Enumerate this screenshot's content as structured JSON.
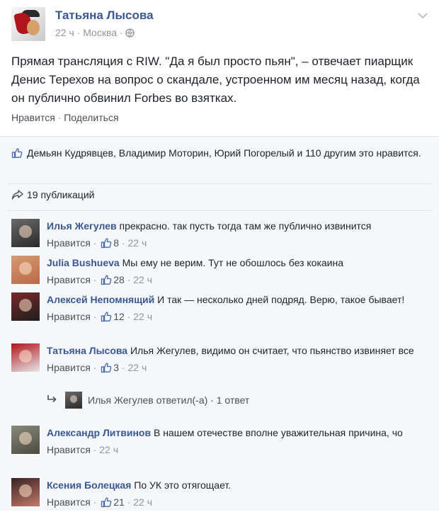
{
  "post": {
    "author": "Татьяна Лысова",
    "time": "22 ч",
    "location": "Москва",
    "meta_sep": " · ",
    "text": "Прямая трансляция с RIW. \"Да я был просто пьян\", – отвечает пиарщик Денис Терехов на вопрос о скандале, устроенном им месяц назад, когда он публично обвинил Forbes во взятках.",
    "like_label": "Нравится",
    "share_label": "Поделиться"
  },
  "feedback": {
    "likes_text": "Демьян Кудрявцев, Владимир Моторин, Юрий Погорелый и 110 другим это нравится.",
    "shares_text": "19 публикаций"
  },
  "comments": [
    {
      "author": "Илья Жегулев",
      "text": " прекрасно. так пусть тогда там же публично извинится",
      "like_label": "Нравится",
      "likes": "8",
      "time": "22 ч",
      "avatar_colors": [
        "#6a6a6a",
        "#2a2a2a"
      ]
    },
    {
      "author": "Julia Bushueva",
      "text": " Мы ему не верим. Тут не обошлось без кокаина",
      "like_label": "Нравится",
      "likes": "28",
      "time": "22 ч",
      "avatar_colors": [
        "#d89a72",
        "#b86a48"
      ]
    },
    {
      "author": "Алексей Непомнящий",
      "text": " И так — несколько дней подряд. Верю, такое бывает!",
      "like_label": "Нравится",
      "likes": "12",
      "time": "22 ч",
      "avatar_colors": [
        "#7a2a2a",
        "#1e1e1e"
      ]
    },
    {
      "author": "Татьяна Лысова",
      "text": " Илья Жегулев, видимо он считает, что пьянство извиняет все",
      "like_label": "Нравится",
      "likes": "3",
      "time": "22 ч",
      "avatar_colors": [
        "#b0151c",
        "#e6e6e6"
      ]
    },
    {
      "author": "Александр Литвинов",
      "text": " В нашем отечестве вполне уважительная причина, чо",
      "like_label": "Нравится",
      "likes": "",
      "time": "22 ч",
      "avatar_colors": [
        "#8a8a7a",
        "#4a4a40"
      ]
    },
    {
      "author": "Ксения Болецкая",
      "text": " По УК это отягощает.",
      "like_label": "Нравится",
      "likes": "21",
      "time": "22 ч",
      "avatar_colors": [
        "#3a2222",
        "#c07a6a"
      ]
    }
  ],
  "reply": {
    "text": "Илья Жегулев ответил(-а) · 1 ответ"
  },
  "colors": {
    "link": "#365899",
    "meta": "#90949c",
    "feedback_bg": "#f6f7f9"
  }
}
